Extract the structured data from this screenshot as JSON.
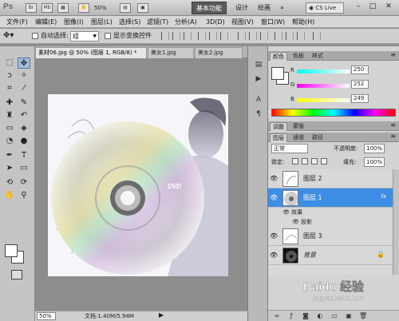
{
  "titlebar": {
    "logo": "Ps",
    "zoom": "50%",
    "workspace_buttons": [
      "基本功能",
      "设计",
      "绘画"
    ],
    "more": "»",
    "cs_live": "CS Live",
    "window_controls": [
      "–",
      "□",
      "✕"
    ]
  },
  "menu": [
    "文件(F)",
    "编辑(E)",
    "图像(I)",
    "图层(L)",
    "选择(S)",
    "滤镜(T)",
    "分析(A)",
    "3D(D)",
    "视图(V)",
    "窗口(W)",
    "帮助(H)"
  ],
  "options": {
    "auto_select_label": "自动选择:",
    "auto_select_value": "组",
    "show_transform_label": "显示变换控件"
  },
  "doc_tabs": [
    {
      "label": "素材06.jpg @ 50% (图层 1, RGB/8) *",
      "active": true
    },
    {
      "label": "美女1.jpg",
      "active": false
    },
    {
      "label": "美女2.jpg",
      "active": false
    }
  ],
  "status": {
    "zoom": "50%",
    "doc_info": "文档:1.40M/5.94M"
  },
  "color_panel": {
    "tabs": [
      "颜色",
      "色板",
      "样式"
    ],
    "sliders": [
      {
        "label": "R",
        "value": "250",
        "color": "#fa0000"
      },
      {
        "label": "G",
        "value": "252",
        "color": "#00fc00"
      },
      {
        "label": "B",
        "value": "249",
        "color": "#0000f9"
      }
    ]
  },
  "adjust_panel": {
    "tabs": [
      "调整",
      "蒙版"
    ]
  },
  "layers_panel": {
    "tabs": [
      "图层",
      "通道",
      "路径"
    ],
    "blend_mode": "正常",
    "opacity_label": "不透明度:",
    "opacity_value": "100%",
    "lock_label": "锁定:",
    "fill_label": "填充:",
    "fill_value": "100%",
    "layers": [
      {
        "name": "图层 2",
        "selected": false,
        "fx": false,
        "locked": false
      },
      {
        "name": "图层 1",
        "selected": true,
        "fx": true,
        "locked": false
      },
      {
        "name": "图层 3",
        "selected": false,
        "fx": false,
        "locked": false
      },
      {
        "name": "背景",
        "selected": false,
        "fx": false,
        "locked": true
      }
    ],
    "effects_label": "效果",
    "effect_item": "投影",
    "fx_text": "fx"
  },
  "artwork": {
    "dvd_text": "DVD"
  },
  "watermark": {
    "text": "Baidu 经验",
    "url": "jingyan.baidu.com"
  }
}
